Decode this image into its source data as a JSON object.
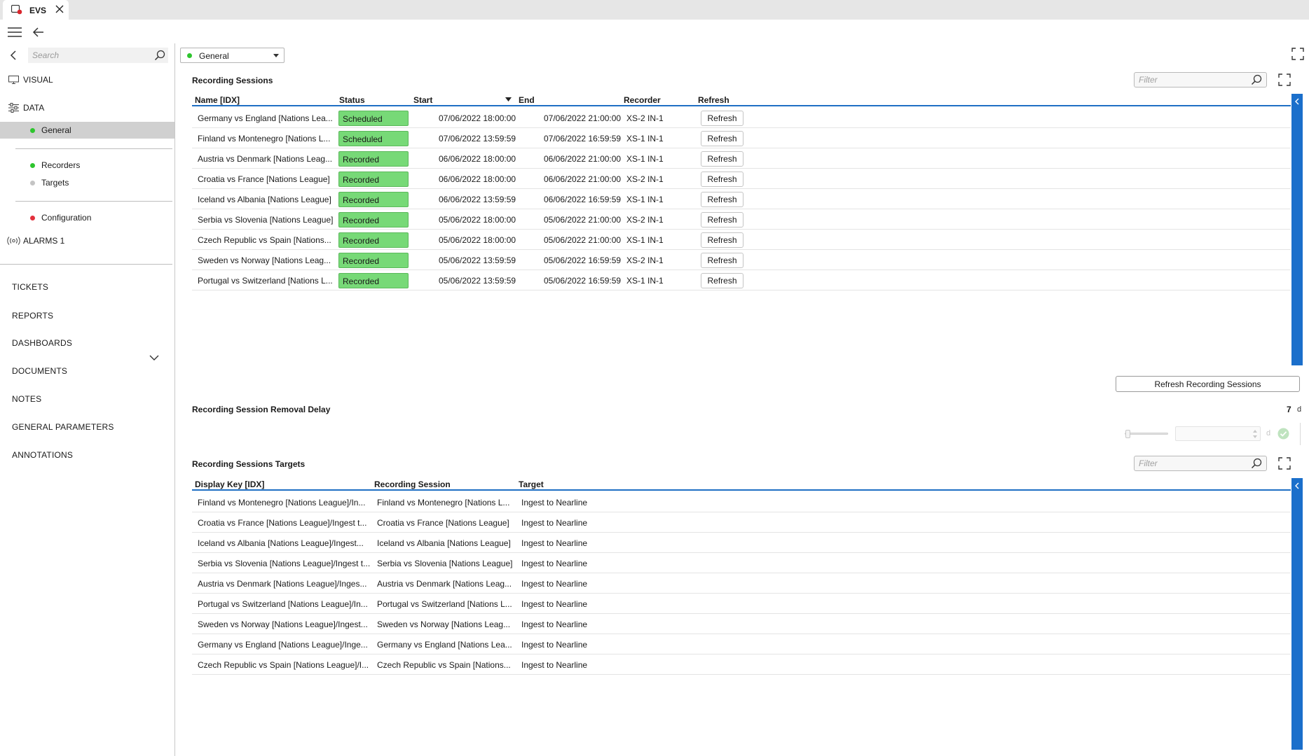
{
  "tab": {
    "title": "EVS"
  },
  "sidebar": {
    "search_placeholder": "Search",
    "visual": "VISUAL",
    "data": "DATA",
    "general": "General",
    "recorders": "Recorders",
    "targets": "Targets",
    "configuration": "Configuration",
    "alarms": "ALARMS 1",
    "menu": [
      "TICKETS",
      "REPORTS",
      "DASHBOARDS",
      "DOCUMENTS",
      "NOTES",
      "GENERAL PARAMETERS",
      "ANNOTATIONS"
    ]
  },
  "colors": {
    "ok": "#2ec52e",
    "warn": "#e3303c",
    "inactive": "#c4c4c4",
    "accent": "#1b6fcb",
    "status_fill": "#77d977"
  },
  "general_select": {
    "value": "General"
  },
  "sessions": {
    "title": "Recording Sessions",
    "filter_placeholder": "Filter",
    "columns": {
      "name": "Name [IDX]",
      "status": "Status",
      "start": "Start",
      "end": "End",
      "recorder": "Recorder",
      "refresh": "Refresh"
    },
    "rows": [
      {
        "name": "Germany vs England [Nations Lea...",
        "status": "Scheduled",
        "start": "07/06/2022 18:00:00",
        "end": "07/06/2022 21:00:00",
        "recorder": "XS-2 IN-1",
        "refresh": "Refresh"
      },
      {
        "name": "Finland vs Montenegro [Nations L...",
        "status": "Scheduled",
        "start": "07/06/2022 13:59:59",
        "end": "07/06/2022 16:59:59",
        "recorder": "XS-1 IN-1",
        "refresh": "Refresh"
      },
      {
        "name": "Austria vs Denmark [Nations Leag...",
        "status": "Recorded",
        "start": "06/06/2022 18:00:00",
        "end": "06/06/2022 21:00:00",
        "recorder": "XS-1 IN-1",
        "refresh": "Refresh"
      },
      {
        "name": "Croatia vs France [Nations League]",
        "status": "Recorded",
        "start": "06/06/2022 18:00:00",
        "end": "06/06/2022 21:00:00",
        "recorder": "XS-2 IN-1",
        "refresh": "Refresh"
      },
      {
        "name": "Iceland vs Albania [Nations League]",
        "status": "Recorded",
        "start": "06/06/2022 13:59:59",
        "end": "06/06/2022 16:59:59",
        "recorder": "XS-1 IN-1",
        "refresh": "Refresh"
      },
      {
        "name": "Serbia vs Slovenia [Nations League]",
        "status": "Recorded",
        "start": "05/06/2022 18:00:00",
        "end": "05/06/2022 21:00:00",
        "recorder": "XS-2 IN-1",
        "refresh": "Refresh"
      },
      {
        "name": "Czech Republic vs Spain [Nations...",
        "status": "Recorded",
        "start": "05/06/2022 18:00:00",
        "end": "05/06/2022 21:00:00",
        "recorder": "XS-1 IN-1",
        "refresh": "Refresh"
      },
      {
        "name": "Sweden vs Norway [Nations Leag...",
        "status": "Recorded",
        "start": "05/06/2022 13:59:59",
        "end": "05/06/2022 16:59:59",
        "recorder": "XS-2 IN-1",
        "refresh": "Refresh"
      },
      {
        "name": "Portugal vs Switzerland [Nations L...",
        "status": "Recorded",
        "start": "05/06/2022 13:59:59",
        "end": "05/06/2022 16:59:59",
        "recorder": "XS-1 IN-1",
        "refresh": "Refresh"
      }
    ],
    "refresh_all": "Refresh Recording Sessions"
  },
  "removal_delay": {
    "title": "Recording Session Removal Delay",
    "value": "7",
    "unit": "d",
    "stepper_unit": "d"
  },
  "targets": {
    "title": "Recording Sessions Targets",
    "filter_placeholder": "Filter",
    "columns": {
      "key": "Display Key [IDX]",
      "session": "Recording Session",
      "target": "Target"
    },
    "rows": [
      {
        "key": "Finland vs Montenegro [Nations League]/In...",
        "session": "Finland vs Montenegro [Nations L...",
        "target": "Ingest to Nearline"
      },
      {
        "key": "Croatia vs France [Nations League]/Ingest t...",
        "session": "Croatia vs France [Nations League]",
        "target": "Ingest to Nearline"
      },
      {
        "key": "Iceland vs Albania [Nations League]/Ingest...",
        "session": "Iceland vs Albania [Nations League]",
        "target": "Ingest to Nearline"
      },
      {
        "key": "Serbia vs Slovenia [Nations League]/Ingest t...",
        "session": "Serbia vs Slovenia [Nations League]",
        "target": "Ingest to Nearline"
      },
      {
        "key": "Austria vs Denmark [Nations League]/Inges...",
        "session": "Austria vs Denmark [Nations Leag...",
        "target": "Ingest to Nearline"
      },
      {
        "key": "Portugal vs Switzerland [Nations League]/In...",
        "session": "Portugal vs Switzerland [Nations L...",
        "target": "Ingest to Nearline"
      },
      {
        "key": "Sweden vs Norway [Nations League]/Ingest...",
        "session": "Sweden vs Norway [Nations Leag...",
        "target": "Ingest to Nearline"
      },
      {
        "key": "Germany vs England [Nations League]/Inge...",
        "session": "Germany vs England [Nations Lea...",
        "target": "Ingest to Nearline"
      },
      {
        "key": "Czech Republic vs Spain [Nations League]/I...",
        "session": "Czech Republic vs Spain [Nations...",
        "target": "Ingest to Nearline"
      }
    ]
  }
}
